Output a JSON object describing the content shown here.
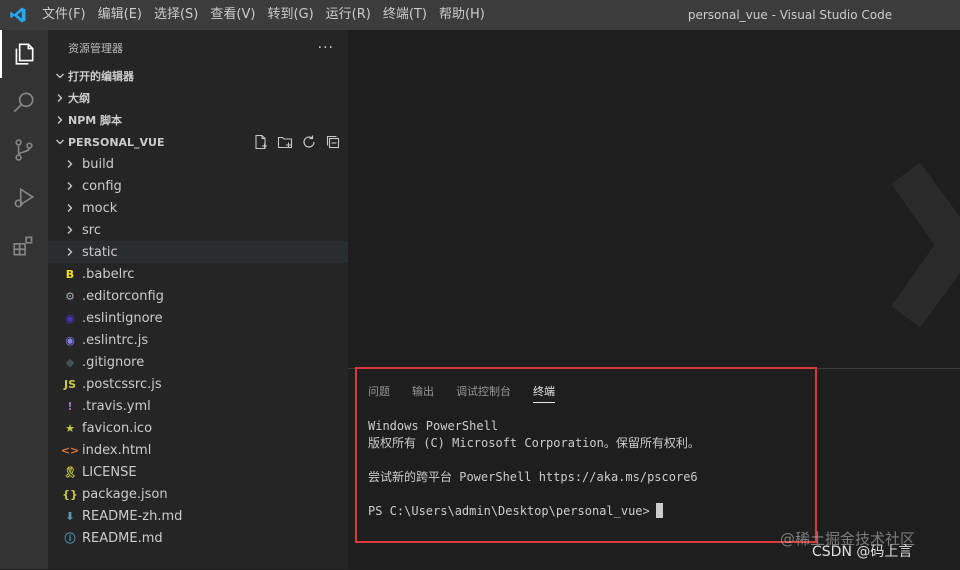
{
  "menu": [
    "文件(F)",
    "编辑(E)",
    "选择(S)",
    "查看(V)",
    "转到(G)",
    "运行(R)",
    "终端(T)",
    "帮助(H)"
  ],
  "window_title": "personal_vue - Visual Studio Code",
  "activity": [
    "files-icon",
    "search-icon",
    "source-control-icon",
    "run-debug-icon",
    "extensions-icon"
  ],
  "sidebar": {
    "title": "资源管理器",
    "more": "···",
    "sections": [
      "打开的编辑器",
      "大纲",
      "NPM 脚本"
    ],
    "project": "PERSONAL_VUE",
    "folders": [
      "build",
      "config",
      "mock",
      "src",
      "static"
    ],
    "files": [
      {
        "name": ".babelrc",
        "icon": "babel-icon",
        "glyph": "B",
        "color": "#f5de19"
      },
      {
        "name": ".editorconfig",
        "icon": "gear-icon",
        "glyph": "⚙",
        "color": "#9da5b4"
      },
      {
        "name": ".eslintignore",
        "icon": "eslint-icon",
        "glyph": "◉",
        "color": "#4b32c3"
      },
      {
        "name": ".eslintrc.js",
        "icon": "eslint-icon",
        "glyph": "◉",
        "color": "#8080f2"
      },
      {
        "name": ".gitignore",
        "icon": "git-icon",
        "glyph": "◆",
        "color": "#41535b"
      },
      {
        "name": ".postcssrc.js",
        "icon": "js-icon",
        "glyph": "JS",
        "color": "#cbcb41"
      },
      {
        "name": ".travis.yml",
        "icon": "yaml-icon",
        "glyph": "!",
        "color": "#a074c4"
      },
      {
        "name": "favicon.ico",
        "icon": "star-icon",
        "glyph": "★",
        "color": "#cbcb41"
      },
      {
        "name": "index.html",
        "icon": "html-icon",
        "glyph": "<>",
        "color": "#e37933"
      },
      {
        "name": "LICENSE",
        "icon": "license-icon",
        "glyph": "🎗",
        "color": "#cbcb41"
      },
      {
        "name": "package.json",
        "icon": "json-icon",
        "glyph": "{}",
        "color": "#cbcb41"
      },
      {
        "name": "README-zh.md",
        "icon": "download-icon",
        "glyph": "⬇",
        "color": "#519aba"
      },
      {
        "name": "README.md",
        "icon": "info-icon",
        "glyph": "ⓘ",
        "color": "#519aba"
      }
    ]
  },
  "panel": {
    "tabs": [
      "问题",
      "输出",
      "调试控制台",
      "终端"
    ],
    "active_tab": "终端",
    "lines": [
      "Windows PowerShell",
      "版权所有 (C) Microsoft Corporation。保留所有权利。",
      "",
      "尝试新的跨平台 PowerShell https://aka.ms/pscore6",
      "",
      "PS C:\\Users\\admin\\Desktop\\personal_vue>"
    ]
  },
  "watermark": "@稀土掘金技术社区",
  "credit": "CSDN @码上言"
}
